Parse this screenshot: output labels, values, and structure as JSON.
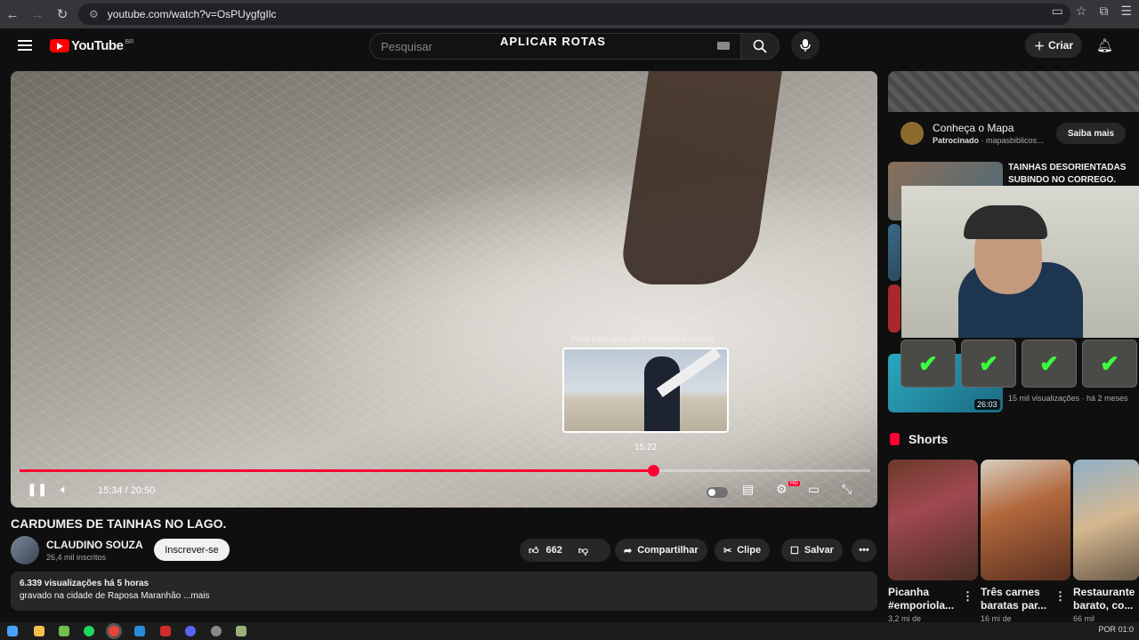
{
  "browser": {
    "url": "youtube.com/watch?v=OsPUygfgIlc"
  },
  "header": {
    "logo_text": "YouTube",
    "country": "BR",
    "search_placeholder": "Pesquisar",
    "overlay_title": "APLICAR ROTAS",
    "create_label": "Criar"
  },
  "player": {
    "hint": "Puxe para cima para uma busca precisa",
    "preview_time": "15:22",
    "time_display": "15:34 / 20:50",
    "progress": 0.745,
    "accent": "#ff0033"
  },
  "video": {
    "title": "CARDUMES DE TAINHAS NO LAGO.",
    "channel": "CLAUDINO SOUZA",
    "subscribers": "26,4 mil inscritos",
    "subscribe_label": "Inscrever-se",
    "likes": "662",
    "share_label": "Compartilhar",
    "clip_label": "Clipe",
    "save_label": "Salvar",
    "views_line": "6.339 visualizações  há 5 horas",
    "description": "gravado na cidade de Raposa Maranhão ...mais"
  },
  "sidebar": {
    "ad_title": "Conheça o Mapa",
    "ad_sponsored": "Patrocinado",
    "ad_domain": "mapasbiblicos...",
    "ad_button": "Saiba mais",
    "rec1_title": "TAINHAS DESORIENTADAS SUBINDO NO CORREGO.",
    "rec2_duration": "26:03",
    "rec2_meta": "15 mil visualizações · há 2 meses",
    "shorts_label": "Shorts",
    "shorts": [
      {
        "title": "Picanha #emporiola...",
        "views": "3,2 mi de"
      },
      {
        "title": "Três carnes baratas par...",
        "views": "16 mi de"
      },
      {
        "title": "Restaurante barato, co...",
        "views": "66 mil"
      }
    ]
  },
  "taskbar": {
    "lang": "POR",
    "clock": "01:0"
  }
}
